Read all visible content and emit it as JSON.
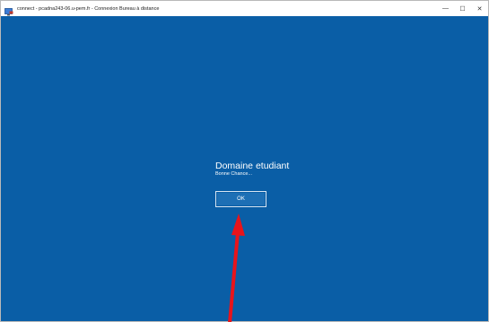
{
  "window": {
    "title": "connect - pcadna243-06.u-pem.fr - Connexion Bureau à distance",
    "controls": {
      "minimize": "—",
      "maximize": "☐",
      "close": "✕"
    }
  },
  "dialog": {
    "title": "Domaine etudiant",
    "subtitle": "Bonne Chance...",
    "ok_label": "OK"
  },
  "colors": {
    "desktop_background": "#0a5ea6",
    "arrow": "#e8141b"
  },
  "icons": {
    "app": "remote-desktop-icon",
    "annotation": "red-arrow-icon"
  }
}
